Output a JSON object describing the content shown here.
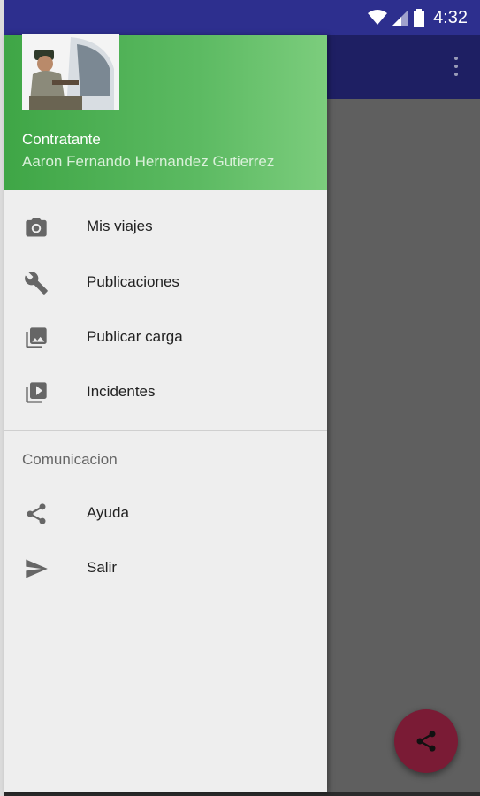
{
  "status_bar": {
    "time": "4:32",
    "background": "#2d2f8e"
  },
  "app_bar": {
    "background": "#1e1f63",
    "overflow_icon": "more-vert-icon"
  },
  "drawer": {
    "header": {
      "title": "Contratante",
      "subtitle": "Aaron Fernando Hernandez Gutierrez",
      "gradient": [
        "#3fa646",
        "#7ccd7d"
      ]
    },
    "items": [
      {
        "label": "Mis viajes",
        "icon": "camera-icon"
      },
      {
        "label": "Publicaciones",
        "icon": "wrench-icon"
      },
      {
        "label": "Publicar carga",
        "icon": "photo-library-icon"
      },
      {
        "label": "Incidentes",
        "icon": "video-library-icon"
      }
    ],
    "section": {
      "title": "Comunicacion",
      "items": [
        {
          "label": "Ayuda",
          "icon": "share-icon"
        },
        {
          "label": "Salir",
          "icon": "send-icon"
        }
      ]
    }
  },
  "fab": {
    "icon": "share-icon",
    "color": "#7a1b35"
  }
}
